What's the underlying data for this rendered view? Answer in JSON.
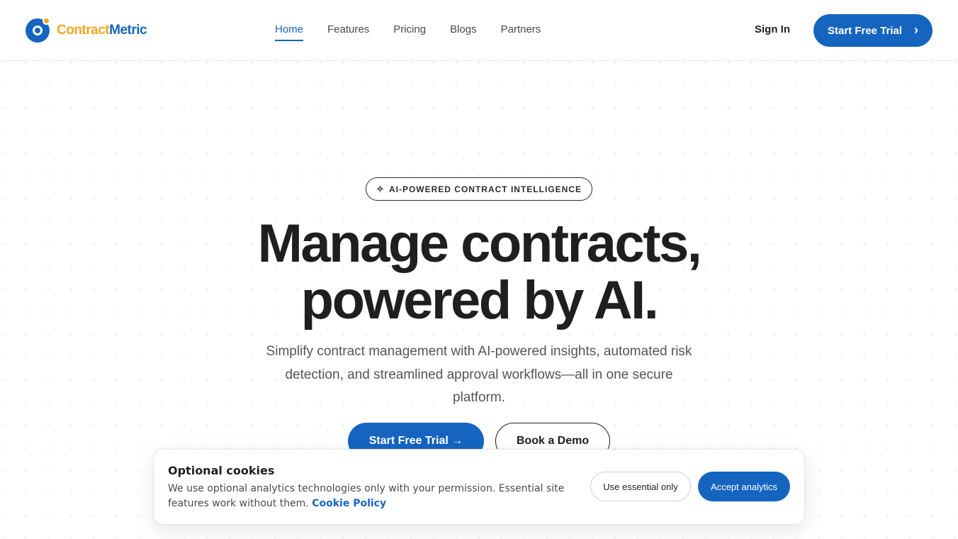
{
  "brand": {
    "name_part1": "Contract",
    "name_part2": "Metric",
    "colors": {
      "primary": "#1565c0",
      "accent": "#f5a623",
      "text": "#1f1f1f"
    }
  },
  "nav": {
    "items": [
      {
        "label": "Home",
        "active": true
      },
      {
        "label": "Features",
        "active": false
      },
      {
        "label": "Pricing",
        "active": false
      },
      {
        "label": "Blogs",
        "active": false
      },
      {
        "label": "Partners",
        "active": false
      }
    ],
    "sign_in": "Sign In",
    "cta_label": "Start Free Trial",
    "cta_icon": "chevron-right-icon"
  },
  "hero": {
    "badge": "AI-POWERED CONTRACT INTELLIGENCE",
    "badge_icon": "sparkle-icon",
    "headline_line1": "Manage contracts,",
    "headline_line2": "powered by AI.",
    "subhead": "Simplify contract management with AI-powered insights, automated risk detection, and streamlined approval workflows—all in one secure platform.",
    "primary_cta": "Start Free Trial →",
    "secondary_cta": "Book a Demo"
  },
  "cookie_banner": {
    "title": "Optional cookies",
    "text": "We use optional analytics technologies only with your permission. Essential site features work without them.",
    "link_label": "Cookie Policy",
    "essential_button": "Use essential only",
    "accept_button": "Accept analytics"
  }
}
